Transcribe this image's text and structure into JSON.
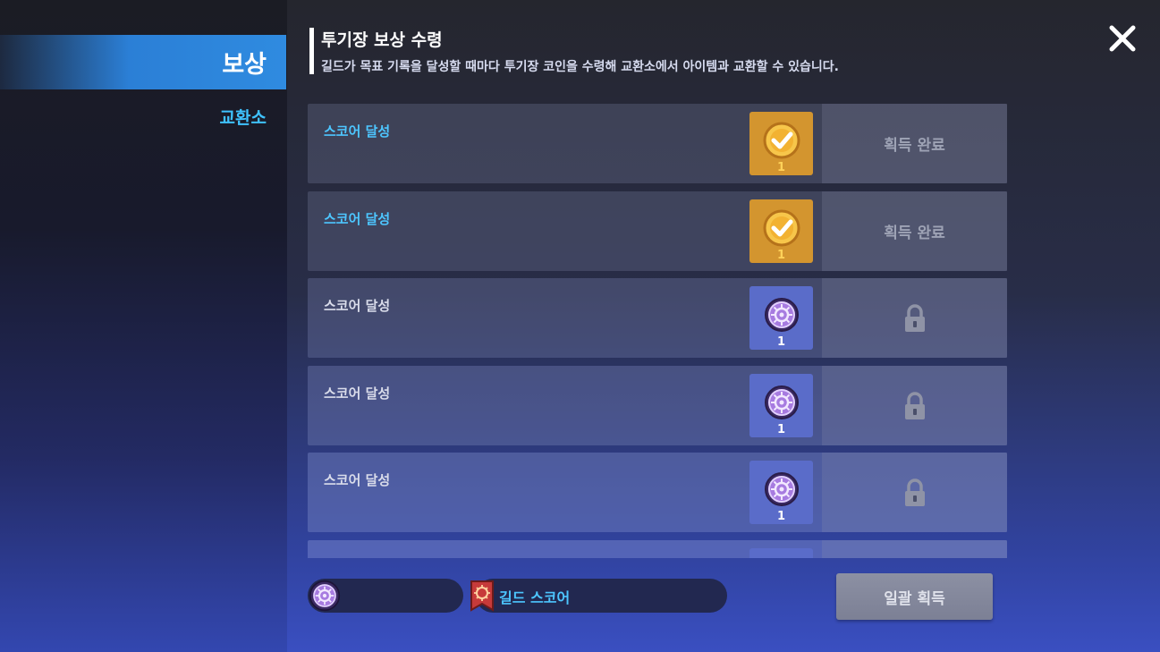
{
  "sidebar": {
    "active_tab": "보상",
    "tabs": [
      "교환소"
    ]
  },
  "header": {
    "title": "투기장 보상 수령",
    "subtitle": "길드가 목표 기록을 달성할 때마다 투기장 코인을 수령해 교환소에서 아이템과 교환할 수 있습니다."
  },
  "rewards": [
    {
      "label": "스코어 달성",
      "item_icon": "check-coin-icon",
      "count": "1",
      "status": "획득 완료",
      "state": "claimed"
    },
    {
      "label": "스코어 달성",
      "item_icon": "check-coin-icon",
      "count": "1",
      "status": "획득 완료",
      "state": "claimed"
    },
    {
      "label": "스코어 달성",
      "item_icon": "arena-coin-icon",
      "count": "1",
      "status": "",
      "state": "locked"
    },
    {
      "label": "스코어 달성",
      "item_icon": "arena-coin-icon",
      "count": "1",
      "status": "",
      "state": "locked"
    },
    {
      "label": "스코어 달성",
      "item_icon": "arena-coin-icon",
      "count": "1",
      "status": "",
      "state": "locked"
    }
  ],
  "footer": {
    "guild_score_label": "길드 스코어",
    "claim_all_label": "일괄 획득"
  },
  "colors": {
    "accent_blue": "#4dc6ff",
    "gold_item": "#d3952f",
    "blue_item": "#5a6cc9"
  }
}
